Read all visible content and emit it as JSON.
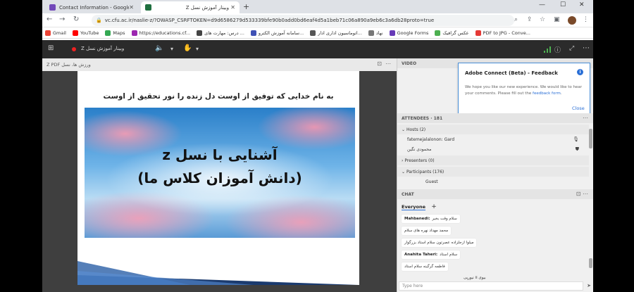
{
  "browser": {
    "tabs": [
      {
        "label": "Contact Information - Google F...",
        "active": false,
        "color": "#7248b9"
      },
      {
        "label": "وبینار آموزش نسل Z",
        "active": true,
        "color": "#1f6f3f"
      }
    ],
    "address": "vc.cfu.ac.ir/naslie-z/?OWASP_CSRFTOKEN=d9d6586279d533339bfe90b0add0bd6eaf4d5a1beb71c06a890a9eb6c3a6db28proto=true"
  },
  "bookmarks": [
    {
      "label": "Gmail",
      "color": "#ea4335"
    },
    {
      "label": "YouTube",
      "color": "#ff0000"
    },
    {
      "label": "Maps",
      "color": "#34a853"
    },
    {
      "label": "https://educations.cf...",
      "color": "#9c27b0"
    },
    {
      "label": "درس: مهارت های ...",
      "color": "#444444"
    },
    {
      "label": "سامانه آموزش الکترو...",
      "color": "#3f51b5"
    },
    {
      "label": "اتوماسیون اداری ادار...",
      "color": "#555555"
    },
    {
      "label": "نهاد",
      "color": "#777777"
    },
    {
      "label": "Google Forms",
      "color": "#673ab7"
    },
    {
      "label": "عکس گرافیک",
      "color": "#4caf50"
    },
    {
      "label": "PDF to JPG - Conve...",
      "color": "#e53935"
    }
  ],
  "connect": {
    "meeting_title": "وبینار آموزش نسل Z",
    "pod_title": "ورزش ها، نسل Z PDF",
    "slide": {
      "heading": "به نام خدایی که توفیق از اوست    دل زنده را نور تحقیق از اوست",
      "line1": "آشنایی با نسل z",
      "line2": "(دانش آموزان کلاس ما)"
    },
    "video_label": "VIDEO",
    "feedback": {
      "title": "Adobe Connect (Beta) - Feedback",
      "body": "We hope you like our new experience. We would like to hear your comments. Please fill out the",
      "link": "feedback form",
      "close": "Close"
    },
    "attendees": {
      "header": "ATTENDEES",
      "count": "181",
      "hosts_label": "Hosts (2)",
      "hosts": [
        "fatemejalalonon: Gard",
        "محمودی نگین"
      ],
      "presenters_label": "Presenters (0)",
      "participants_label": "Participants (176)",
      "participants": [
        "Guest"
      ]
    },
    "chat": {
      "header": "CHAT",
      "tab": "Everyone",
      "messages": [
        {
          "sender": "Mahbanedi:",
          "text": "سلام وقت بخیر"
        },
        {
          "sender": "",
          "text": "محمد مهداد نهره های سلام"
        },
        {
          "sender": "",
          "text": "میلوا ازجلزاده عصرتون سلام استاد بزرگوار"
        },
        {
          "sender": "Anahita Taheri:",
          "text": "سلام استاد"
        },
        {
          "sender": "",
          "text": "فاطمه گرگینه سلام استاد"
        },
        {
          "sender": "",
          "text": "نیورپی ii بیوی"
        }
      ],
      "input_placeholder": "Type here"
    }
  }
}
